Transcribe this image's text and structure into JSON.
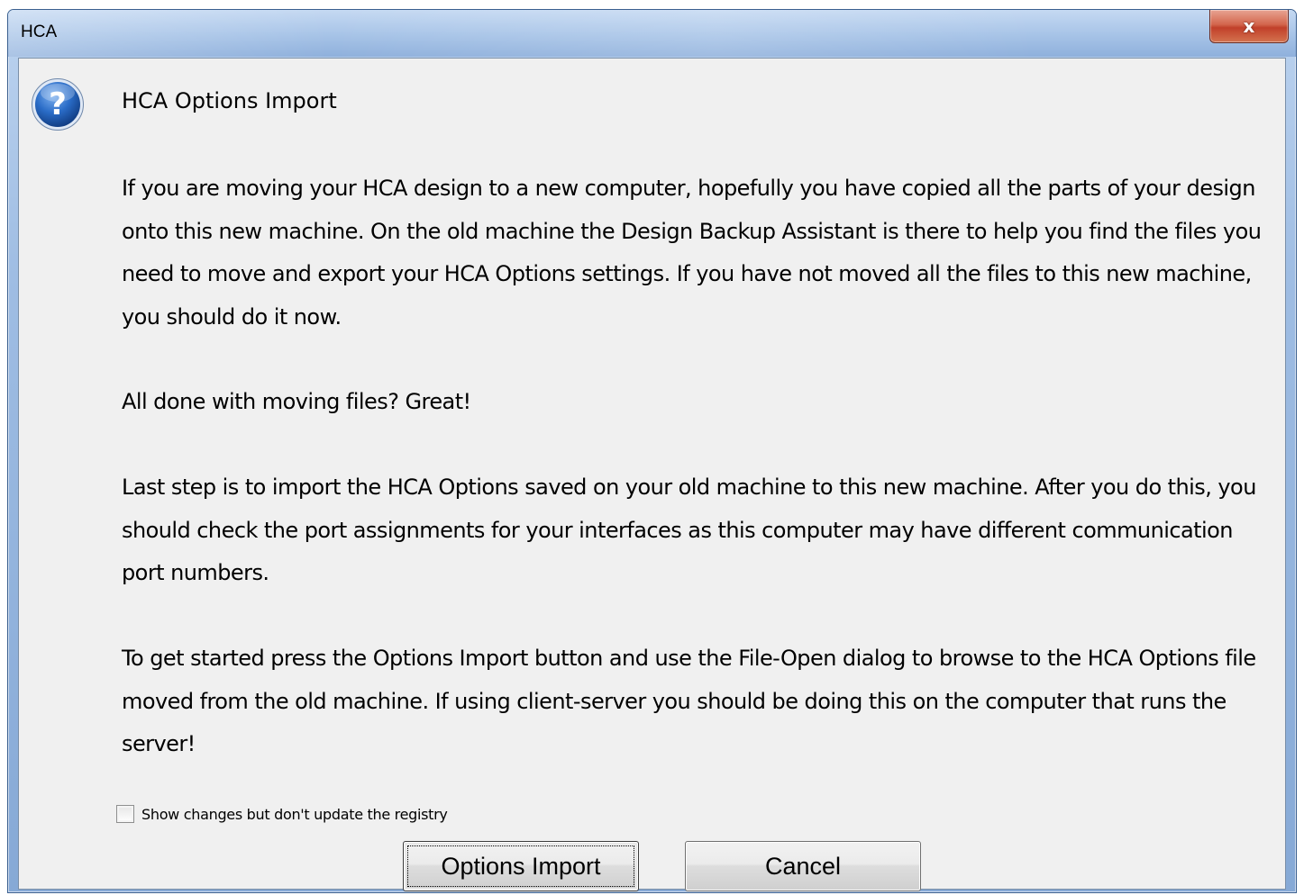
{
  "window": {
    "title": "HCA",
    "close_glyph": "x"
  },
  "dialog": {
    "icon": "question-icon",
    "heading": "HCA Options Import",
    "paragraphs": [
      "If you are moving your HCA design to a new computer, hopefully you have copied all the parts of your design onto this new machine. On the old machine the Design Backup Assistant is there to help you find the files you need to move and export your HCA Options settings. If you have not moved all the files to this new machine, you should do it now.",
      "All done with moving files? Great!",
      "Last step is to import the HCA Options saved on your old machine to this new machine. After you do this, you should check the port assignments for your interfaces as this computer may have different communication port numbers.",
      "To get started press the Options Import button and use the File-Open dialog to browse to the HCA Options file moved from the old machine. If using client-server you should be doing this on the computer that runs the server!"
    ],
    "checkbox": {
      "label": "Show changes but don't update the registry",
      "checked": false
    },
    "buttons": {
      "import_label": "Options Import",
      "cancel_label": "Cancel"
    }
  },
  "colors": {
    "client_background": "#f0f0f0",
    "titlebar": "#a9c5e8",
    "close_button": "#c1402a",
    "icon_blue": "#1f5fb5"
  }
}
